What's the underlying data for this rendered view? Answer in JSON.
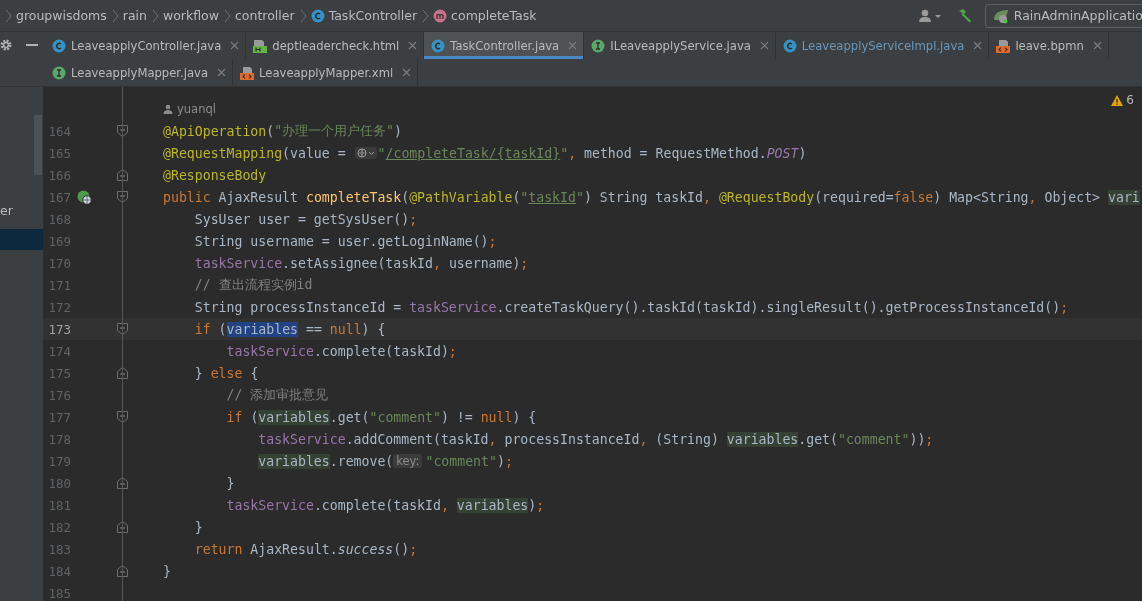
{
  "breadcrumbs": [
    {
      "label": "groupwisdoms",
      "kind": "package"
    },
    {
      "label": "rain",
      "kind": "package"
    },
    {
      "label": "workflow",
      "kind": "package"
    },
    {
      "label": "controller",
      "kind": "package"
    },
    {
      "label": "TaskController",
      "kind": "class"
    },
    {
      "label": "completeTask",
      "kind": "method"
    }
  ],
  "run_config": {
    "label": "RainAdminApplicatio"
  },
  "tab_rows": [
    [
      {
        "label": "LeaveapplyController.java",
        "kind": "class",
        "selected": false,
        "modified": false
      },
      {
        "label": "deptleadercheck.html",
        "kind": "html",
        "selected": false,
        "modified": false
      },
      {
        "label": "TaskController.java",
        "kind": "class",
        "selected": true,
        "modified": false
      },
      {
        "label": "ILeaveapplyService.java",
        "kind": "interface",
        "selected": false,
        "modified": false
      },
      {
        "label": "LeaveapplyServiceImpl.java",
        "kind": "class",
        "selected": false,
        "modified": true
      },
      {
        "label": "leave.bpmn",
        "kind": "xml",
        "selected": false,
        "modified": false
      }
    ],
    [
      {
        "label": "LeaveapplyMapper.java",
        "kind": "interface",
        "selected": false,
        "modified": false
      },
      {
        "label": "LeaveapplyMapper.xml",
        "kind": "xml",
        "selected": false,
        "modified": false
      }
    ]
  ],
  "project_panel": {
    "item_text": "er"
  },
  "editor": {
    "warnings": "6",
    "author": "yuanql",
    "lines": [
      {
        "number": "164",
        "fold_start": true,
        "fold_end": false,
        "endpoint": false,
        "current": false,
        "tokens": [
          {
            "kind": "ann",
            "text": "@ApiOperation"
          },
          {
            "kind": "plain",
            "text": "("
          },
          {
            "kind": "str",
            "text": "\"办理一个用户任务\""
          },
          {
            "kind": "plain",
            "text": ")"
          }
        ]
      },
      {
        "number": "165",
        "fold_start": false,
        "fold_end": false,
        "endpoint": false,
        "current": false,
        "tokens": [
          {
            "kind": "ann",
            "text": "@RequestMapping"
          },
          {
            "kind": "plain",
            "text": "(value = "
          },
          {
            "kind": "globe"
          },
          {
            "kind": "str",
            "text": "\""
          },
          {
            "kind": "link",
            "text": "/completeTask/{taskId}"
          },
          {
            "kind": "str",
            "text": "\""
          },
          {
            "kind": "kw",
            "text": ","
          },
          {
            "kind": "plain",
            "text": " method = RequestMethod."
          },
          {
            "kind": "const",
            "text": "POST"
          },
          {
            "kind": "plain",
            "text": ")"
          }
        ]
      },
      {
        "number": "166",
        "fold_start": false,
        "fold_end": true,
        "endpoint": false,
        "current": false,
        "tokens": [
          {
            "kind": "ann",
            "text": "@ResponseBody"
          }
        ]
      },
      {
        "number": "167",
        "fold_start": true,
        "fold_end": false,
        "endpoint": true,
        "current": false,
        "tokens": [
          {
            "kind": "kw",
            "text": "public"
          },
          {
            "kind": "plain",
            "text": " AjaxResult "
          },
          {
            "kind": "decl",
            "text": "completeTask"
          },
          {
            "kind": "plain",
            "text": "("
          },
          {
            "kind": "ann",
            "text": "@PathVariable"
          },
          {
            "kind": "plain",
            "text": "("
          },
          {
            "kind": "str",
            "text": "\""
          },
          {
            "kind": "link",
            "text": "taskId"
          },
          {
            "kind": "str",
            "text": "\""
          },
          {
            "kind": "plain",
            "text": ") String taskId"
          },
          {
            "kind": "kw",
            "text": ","
          },
          {
            "kind": "ann",
            "text": " @RequestBody"
          },
          {
            "kind": "plain",
            "text": "(required="
          },
          {
            "kind": "kw",
            "text": "false"
          },
          {
            "kind": "plain",
            "text": ") Map<String"
          },
          {
            "kind": "kw",
            "text": ","
          },
          {
            "kind": "plain",
            "text": " Object> "
          },
          {
            "kind": "usage",
            "text": "vari"
          }
        ]
      },
      {
        "number": "168",
        "fold_start": false,
        "fold_end": false,
        "endpoint": false,
        "current": false,
        "tokens": [
          {
            "kind": "plain",
            "text": "    SysUser user = getSysUser()"
          },
          {
            "kind": "kw",
            "text": ";"
          }
        ]
      },
      {
        "number": "169",
        "fold_start": false,
        "fold_end": false,
        "endpoint": false,
        "current": false,
        "tokens": [
          {
            "kind": "plain",
            "text": "    String username = user.getLoginName()"
          },
          {
            "kind": "kw",
            "text": ";"
          }
        ]
      },
      {
        "number": "170",
        "fold_start": false,
        "fold_end": false,
        "endpoint": false,
        "current": false,
        "tokens": [
          {
            "kind": "field",
            "text": "    taskService"
          },
          {
            "kind": "plain",
            "text": ".setAssignee(taskId"
          },
          {
            "kind": "kw",
            "text": ","
          },
          {
            "kind": "plain",
            "text": " username)"
          },
          {
            "kind": "kw",
            "text": ";"
          }
        ]
      },
      {
        "number": "171",
        "fold_start": false,
        "fold_end": false,
        "endpoint": false,
        "current": false,
        "tokens": [
          {
            "kind": "cmt",
            "text": "    // 查出流程实例id"
          }
        ]
      },
      {
        "number": "172",
        "fold_start": false,
        "fold_end": false,
        "endpoint": false,
        "current": false,
        "tokens": [
          {
            "kind": "plain",
            "text": "    String processInstanceId = "
          },
          {
            "kind": "field",
            "text": "taskService"
          },
          {
            "kind": "plain",
            "text": ".createTaskQuery().taskId(taskId).singleResult().getProcessInstanceId()"
          },
          {
            "kind": "kw",
            "text": ";"
          }
        ]
      },
      {
        "number": "173",
        "fold_start": true,
        "fold_end": false,
        "endpoint": false,
        "current": true,
        "tokens": [
          {
            "kind": "kw",
            "text": "    if"
          },
          {
            "kind": "plain",
            "text": " ("
          },
          {
            "kind": "sel",
            "text": "variables"
          },
          {
            "kind": "plain",
            "text": " == "
          },
          {
            "kind": "kw",
            "text": "null"
          },
          {
            "kind": "plain",
            "text": ") {"
          }
        ]
      },
      {
        "number": "174",
        "fold_start": false,
        "fold_end": false,
        "endpoint": false,
        "current": false,
        "tokens": [
          {
            "kind": "field",
            "text": "        taskService"
          },
          {
            "kind": "plain",
            "text": ".complete(taskId)"
          },
          {
            "kind": "kw",
            "text": ";"
          }
        ]
      },
      {
        "number": "175",
        "fold_start": false,
        "fold_end": true,
        "endpoint": false,
        "current": false,
        "tokens": [
          {
            "kind": "plain",
            "text": "    } "
          },
          {
            "kind": "kw",
            "text": "else"
          },
          {
            "kind": "plain",
            "text": " {"
          }
        ]
      },
      {
        "number": "176",
        "fold_start": false,
        "fold_end": false,
        "endpoint": false,
        "current": false,
        "tokens": [
          {
            "kind": "cmt",
            "text": "        // 添加审批意见"
          }
        ]
      },
      {
        "number": "177",
        "fold_start": true,
        "fold_end": false,
        "endpoint": false,
        "current": false,
        "tokens": [
          {
            "kind": "kw",
            "text": "        if"
          },
          {
            "kind": "plain",
            "text": " ("
          },
          {
            "kind": "usage",
            "text": "variables"
          },
          {
            "kind": "plain",
            "text": ".get("
          },
          {
            "kind": "str",
            "text": "\"comment\""
          },
          {
            "kind": "plain",
            "text": ") != "
          },
          {
            "kind": "kw",
            "text": "null"
          },
          {
            "kind": "plain",
            "text": ") {"
          }
        ]
      },
      {
        "number": "178",
        "fold_start": false,
        "fold_end": false,
        "endpoint": false,
        "current": false,
        "tokens": [
          {
            "kind": "field",
            "text": "            taskService"
          },
          {
            "kind": "plain",
            "text": ".addComment(taskId"
          },
          {
            "kind": "kw",
            "text": ","
          },
          {
            "kind": "plain",
            "text": " processInstanceId"
          },
          {
            "kind": "kw",
            "text": ","
          },
          {
            "kind": "plain",
            "text": " (String) "
          },
          {
            "kind": "usage",
            "text": "variables"
          },
          {
            "kind": "plain",
            "text": ".get("
          },
          {
            "kind": "str",
            "text": "\"comment\""
          },
          {
            "kind": "plain",
            "text": "))"
          },
          {
            "kind": "kw",
            "text": ";"
          }
        ]
      },
      {
        "number": "179",
        "fold_start": false,
        "fold_end": false,
        "endpoint": false,
        "current": false,
        "tokens": [
          {
            "kind": "usage",
            "text": "            variables"
          },
          {
            "kind": "plain",
            "text": ".remove("
          },
          {
            "kind": "hint",
            "text": "key:"
          },
          {
            "kind": "str",
            "text": "\"comment\""
          },
          {
            "kind": "plain",
            "text": ")"
          },
          {
            "kind": "kw",
            "text": ";"
          }
        ]
      },
      {
        "number": "180",
        "fold_start": false,
        "fold_end": true,
        "endpoint": false,
        "current": false,
        "tokens": [
          {
            "kind": "plain",
            "text": "        }"
          }
        ]
      },
      {
        "number": "181",
        "fold_start": false,
        "fold_end": false,
        "endpoint": false,
        "current": false,
        "tokens": [
          {
            "kind": "field",
            "text": "        taskService"
          },
          {
            "kind": "plain",
            "text": ".complete(taskId"
          },
          {
            "kind": "kw",
            "text": ","
          },
          {
            "kind": "usage",
            "text": " variables"
          },
          {
            "kind": "plain",
            "text": ")"
          },
          {
            "kind": "kw",
            "text": ";"
          }
        ]
      },
      {
        "number": "182",
        "fold_start": false,
        "fold_end": true,
        "endpoint": false,
        "current": false,
        "tokens": [
          {
            "kind": "plain",
            "text": "    }"
          }
        ]
      },
      {
        "number": "183",
        "fold_start": false,
        "fold_end": false,
        "endpoint": false,
        "current": false,
        "tokens": [
          {
            "kind": "kw",
            "text": "    return"
          },
          {
            "kind": "plain",
            "text": " AjaxResult."
          },
          {
            "kind": "static",
            "text": "success"
          },
          {
            "kind": "plain",
            "text": "()"
          },
          {
            "kind": "kw",
            "text": ";"
          }
        ]
      },
      {
        "number": "184",
        "fold_start": false,
        "fold_end": true,
        "endpoint": false,
        "current": false,
        "tokens": [
          {
            "kind": "plain",
            "text": "}"
          }
        ]
      },
      {
        "number": "185",
        "fold_start": false,
        "fold_end": false,
        "endpoint": false,
        "current": false
      }
    ]
  }
}
